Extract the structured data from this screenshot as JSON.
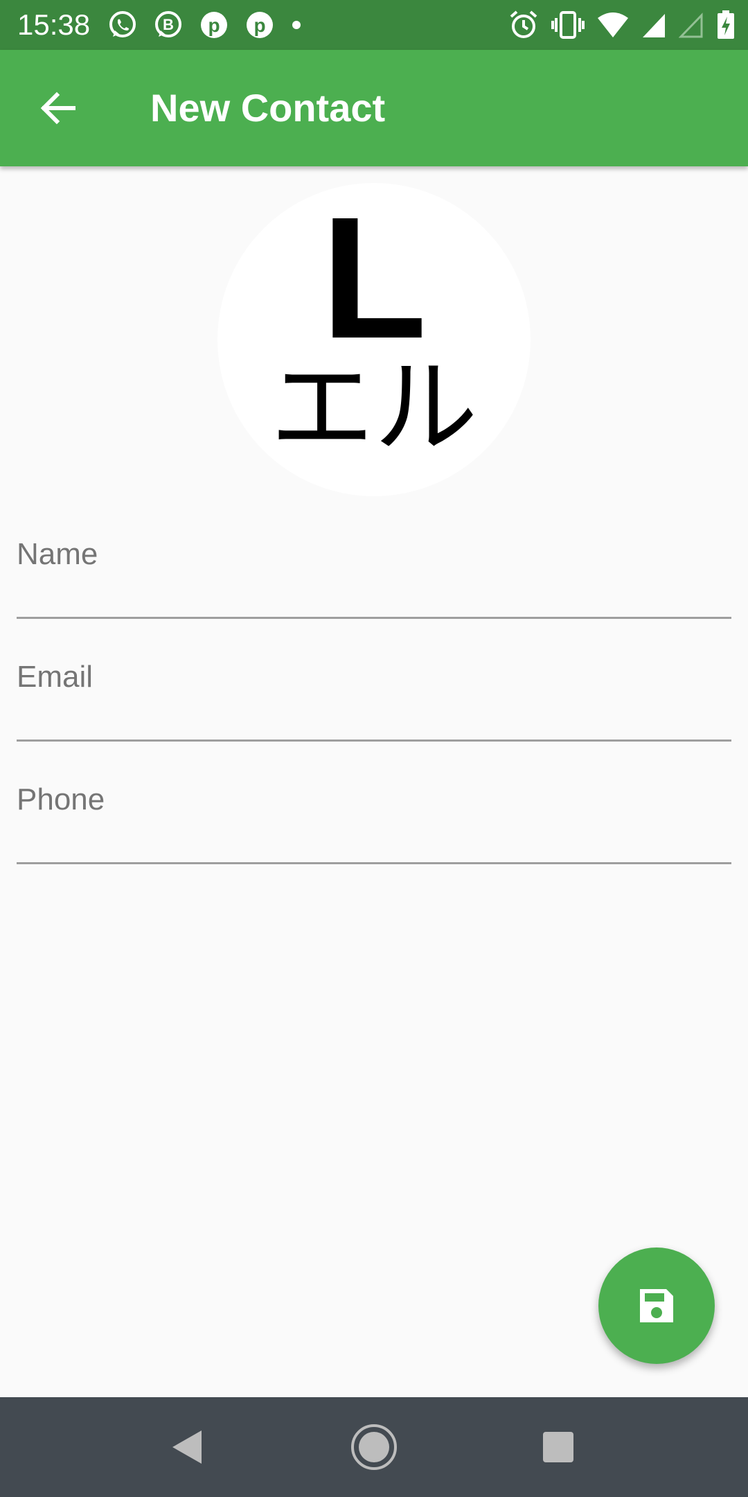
{
  "status_bar": {
    "time": "15:38",
    "notification_icons": [
      "whatsapp-icon",
      "whatsapp-business-icon",
      "pinterest-icon",
      "pinterest-icon",
      "more-dot-icon"
    ],
    "system_icons": [
      "alarm-icon",
      "vibrate-icon",
      "wifi-icon",
      "signal-icon",
      "signal-empty-icon",
      "battery-charging-icon"
    ]
  },
  "app_bar": {
    "back_icon": "arrow-back-icon",
    "title": "New Contact"
  },
  "avatar": {
    "letter": "L",
    "katakana": "エル"
  },
  "form": {
    "name": {
      "label": "Name",
      "value": ""
    },
    "email": {
      "label": "Email",
      "value": ""
    },
    "phone": {
      "label": "Phone",
      "value": ""
    }
  },
  "fab": {
    "icon": "save-icon"
  },
  "nav_bar": {
    "buttons": [
      "nav-back-icon",
      "nav-home-icon",
      "nav-recents-icon"
    ]
  },
  "colors": {
    "status_bar": "#3b873e",
    "primary": "#4caf50",
    "background": "#fafafa",
    "label": "#757575",
    "underline": "#9e9e9e",
    "nav_bar": "#434a51"
  }
}
